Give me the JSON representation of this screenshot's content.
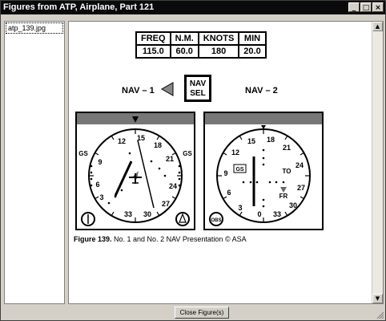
{
  "window": {
    "title": "Figures from ATP, Airplane, Part 121",
    "minimize": "_",
    "maximize": "□",
    "close": "×"
  },
  "sidebar": {
    "items": [
      {
        "label": "atp_139.jpg"
      }
    ]
  },
  "figure": {
    "table": {
      "headers": [
        "FREQ",
        "N.M.",
        "KNOTS",
        "MIN"
      ],
      "values": [
        "115.0",
        "60.0",
        "180",
        "20.0"
      ]
    },
    "nav1": "NAV – 1",
    "nav2": "NAV – 2",
    "navsel": [
      "NAV",
      "SEL"
    ],
    "nav1_card": [
      "12",
      "15",
      "18",
      "21",
      "24",
      "27",
      "30",
      "33",
      "3",
      "6",
      "9"
    ],
    "nav1_gs": "GS",
    "nav2_card": [
      "15",
      "18",
      "21",
      "24",
      "27",
      "30",
      "33",
      "0",
      "3",
      "6",
      "9",
      "12"
    ],
    "nav2_gs": "GS",
    "nav2_to": "TO",
    "nav2_fr": "FR",
    "nav2_obs": "OBS",
    "caption_bold": "Figure 139.",
    "caption_text": " No. 1 and  No. 2 NAV Presentation    © ASA"
  },
  "footer": {
    "close_button": "Close Figure(s)"
  }
}
